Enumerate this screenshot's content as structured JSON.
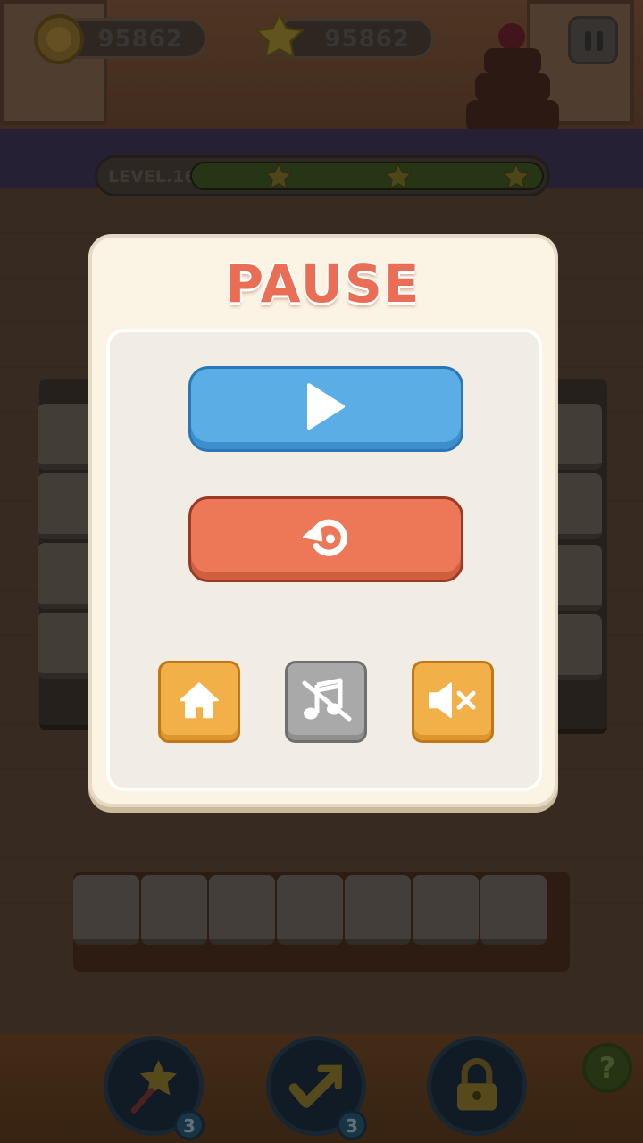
{
  "hud": {
    "coins": "95862",
    "stars": "95862",
    "level_label": "LEVEL.16",
    "level_progress": 1.0
  },
  "dialog": {
    "title": "PAUSE"
  },
  "boosters": {
    "booster1_count": "3",
    "booster2_count": "3",
    "help_label": "?"
  },
  "colors": {
    "play": "#5aaee5",
    "restart": "#ec7857",
    "home": "#f2b048",
    "music_off": "#a9a9a9",
    "sound": "#f2b048",
    "title": "#ea6e55"
  },
  "icons": {
    "play": "play-icon",
    "restart": "restart-icon",
    "home": "home-icon",
    "music": "music-off-icon",
    "sound": "sound-mute-icon",
    "booster1": "star-wand-icon",
    "booster2": "swap-arrow-icon",
    "booster3": "lock-icon"
  }
}
